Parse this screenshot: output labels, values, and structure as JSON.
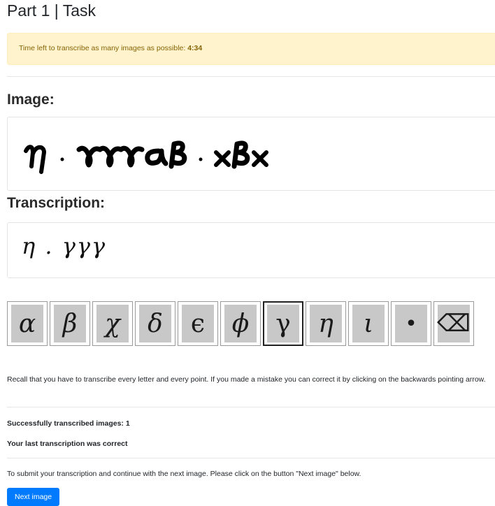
{
  "header": {
    "title": "Part 1 | Task"
  },
  "timer": {
    "prefix": "Time left to transcribe as many images as possible:",
    "value": "4:34"
  },
  "image_section": {
    "heading": "Image:"
  },
  "transcription_section": {
    "heading": "Transcription:",
    "value": "η . γγγ"
  },
  "keyboard": {
    "keys": [
      {
        "symbol": "α",
        "name": "alpha"
      },
      {
        "symbol": "β",
        "name": "beta"
      },
      {
        "symbol": "χ",
        "name": "chi"
      },
      {
        "symbol": "δ",
        "name": "delta"
      },
      {
        "symbol": "ϵ",
        "name": "epsilon"
      },
      {
        "symbol": "ϕ",
        "name": "phi"
      },
      {
        "symbol": "γ",
        "name": "gamma"
      },
      {
        "symbol": "η",
        "name": "eta"
      },
      {
        "symbol": "ι",
        "name": "iota"
      },
      {
        "symbol": "•",
        "name": "point"
      },
      {
        "symbol": "⌫",
        "name": "backspace"
      }
    ],
    "selected": "gamma"
  },
  "instructions": {
    "text": "Recall that you have to transcribe every letter and every point. If you made a mistake you can correct it by clicking on the backwards pointing arrow."
  },
  "stats": {
    "success_label": "Successfully transcribed images: 1",
    "last_result": "Your last transcription was correct"
  },
  "submit": {
    "text": "To submit your transcription and continue with the next image. Please click on the button \"Next image\" below.",
    "button_label": "Next image"
  },
  "colors": {
    "alert_bg": "#fff3cd",
    "alert_text": "#856404",
    "button": "#007bff",
    "key_bg": "#c8c8c8"
  }
}
